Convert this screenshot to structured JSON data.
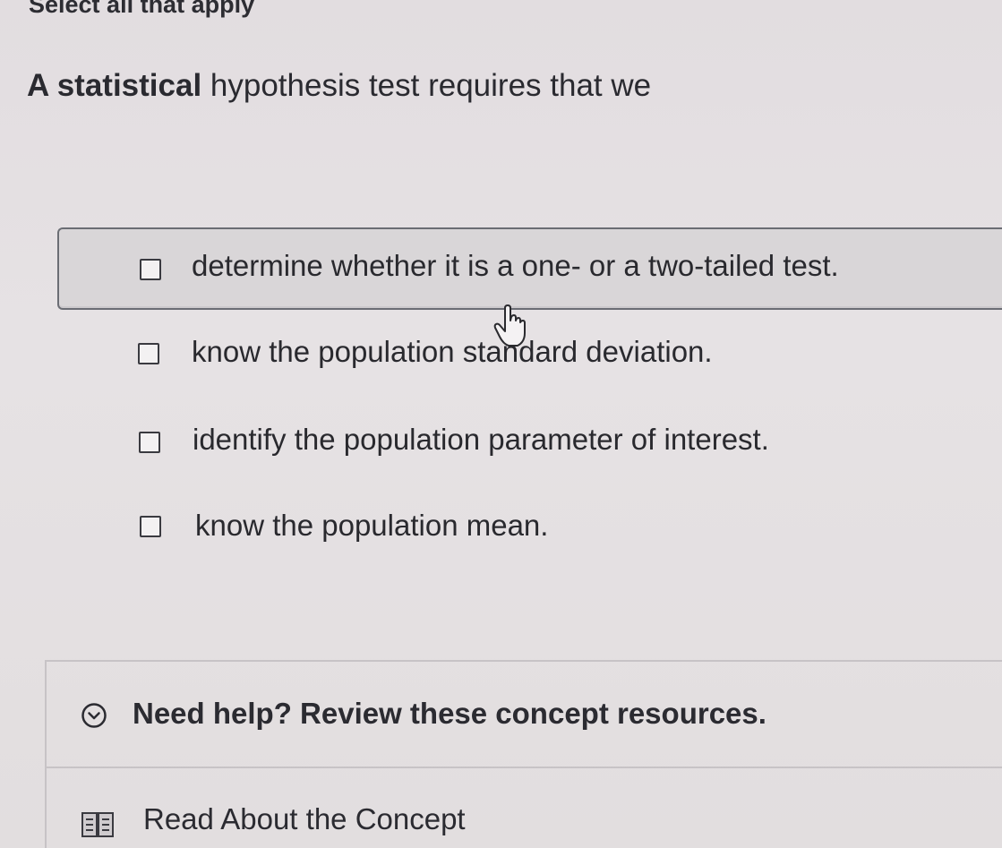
{
  "instruction": "Select all that apply",
  "question": {
    "bold_part": "A statistical",
    "rest": " hypothesis test requires that we"
  },
  "options": [
    {
      "label": "determine whether it is a one- or a two-tailed test.",
      "checked": false,
      "highlighted": true
    },
    {
      "label": "know the population standard deviation.",
      "checked": false,
      "highlighted": false
    },
    {
      "label": "identify the population parameter of interest.",
      "checked": false,
      "highlighted": false
    },
    {
      "label": "know the population mean.",
      "checked": false,
      "highlighted": false
    }
  ],
  "help": {
    "title": "Need help? Review these concept resources.",
    "icon": "chevron-down-circle-icon"
  },
  "resources": [
    {
      "label": "Read About the Concept",
      "icon": "book-icon"
    }
  ],
  "colors": {
    "background": "#e4e0e2",
    "text": "#2a2a2e",
    "highlight": "#d9d6d8",
    "border": "#6b6d74"
  }
}
